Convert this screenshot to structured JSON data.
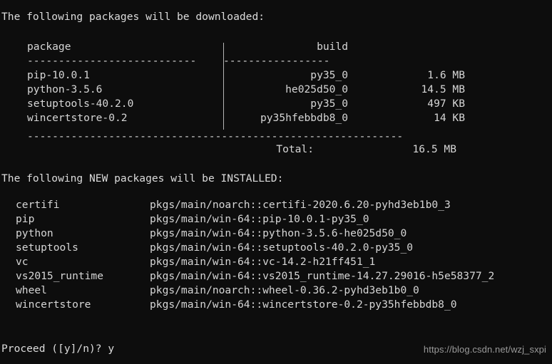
{
  "terminal": {
    "background_color": "#0d0d0d",
    "text_color": "#d6d6d6",
    "download_header": "The following packages will be downloaded:",
    "install_header": "The following NEW packages will be INSTALLED:",
    "prompt": "Proceed ([y]/n)? y",
    "watermark": "https://blog.csdn.net/wzj_sxpi"
  },
  "download_table": {
    "headers": {
      "package": "package",
      "build": "build",
      "size": ""
    },
    "rule_left": "---------------------------",
    "rule_right": "-----------------",
    "rule_full": "------------------------------------------------------------",
    "rows": [
      {
        "package": "pip-10.0.1",
        "build": "py35_0",
        "size": "1.6 MB"
      },
      {
        "package": "python-3.5.6",
        "build": "he025d50_0",
        "size": "14.5 MB"
      },
      {
        "package": "setuptools-40.2.0",
        "build": "py35_0",
        "size": "497 KB"
      },
      {
        "package": "wincertstore-0.2",
        "build": "py35hfebbdb8_0",
        "size": "14 KB"
      }
    ],
    "total_label": "Total:",
    "total_value": "16.5 MB"
  },
  "install_list": {
    "rows": [
      {
        "name": "certifi",
        "spec": "pkgs/main/noarch::certifi-2020.6.20-pyhd3eb1b0_3"
      },
      {
        "name": "pip",
        "spec": "pkgs/main/win-64::pip-10.0.1-py35_0"
      },
      {
        "name": "python",
        "spec": "pkgs/main/win-64::python-3.5.6-he025d50_0"
      },
      {
        "name": "setuptools",
        "spec": "pkgs/main/win-64::setuptools-40.2.0-py35_0"
      },
      {
        "name": "vc",
        "spec": "pkgs/main/win-64::vc-14.2-h21ff451_1"
      },
      {
        "name": "vs2015_runtime",
        "spec": "pkgs/main/win-64::vs2015_runtime-14.27.29016-h5e58377_2"
      },
      {
        "name": "wheel",
        "spec": "pkgs/main/noarch::wheel-0.36.2-pyhd3eb1b0_0"
      },
      {
        "name": "wincertstore",
        "spec": "pkgs/main/win-64::wincertstore-0.2-py35hfebbdb8_0"
      }
    ]
  }
}
